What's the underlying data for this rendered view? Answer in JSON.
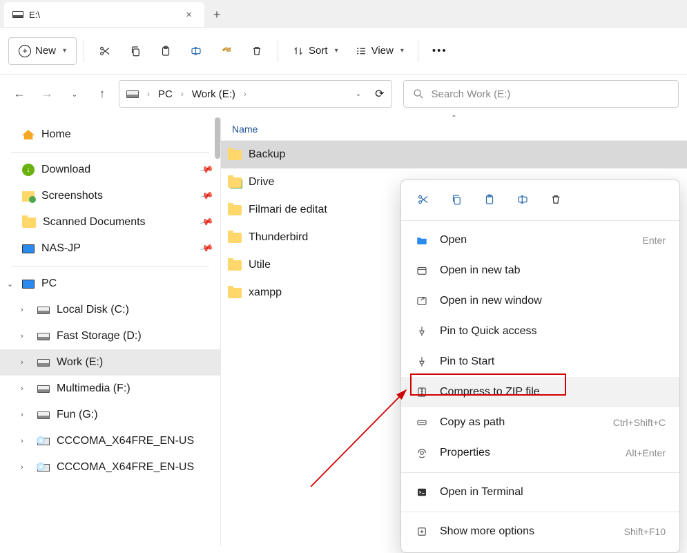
{
  "tab": {
    "title": "E:\\"
  },
  "toolbar": {
    "new": "New",
    "sort": "Sort",
    "view": "View"
  },
  "breadcrumb": {
    "pc": "PC",
    "drive": "Work (E:)"
  },
  "search": {
    "placeholder": "Search Work (E:)"
  },
  "sidebar": {
    "home": "Home",
    "quick": [
      {
        "icon": "dl",
        "label": "Download",
        "pinned": true
      },
      {
        "icon": "ss",
        "label": "Screenshots",
        "pinned": true
      },
      {
        "icon": "folder",
        "label": "Scanned Documents",
        "pinned": true
      },
      {
        "icon": "mon",
        "label": "NAS-JP",
        "pinned": true
      }
    ],
    "pc": "PC",
    "drives": [
      {
        "label": "Local Disk (C:)",
        "icon": "drive"
      },
      {
        "label": "Fast Storage (D:)",
        "icon": "drive"
      },
      {
        "label": "Work (E:)",
        "icon": "drive",
        "selected": true
      },
      {
        "label": "Multimedia (F:)",
        "icon": "drive"
      },
      {
        "label": "Fun (G:)",
        "icon": "drive"
      },
      {
        "label": "CCCOMA_X64FRE_EN-US",
        "icon": "dvd"
      },
      {
        "label": "CCCOMA_X64FRE_EN-US",
        "icon": "dvd"
      }
    ]
  },
  "file_list": {
    "header": "Name",
    "items": [
      {
        "name": "Backup",
        "selected": true
      },
      {
        "name": "Drive",
        "overlay": true
      },
      {
        "name": "Filmari de editat"
      },
      {
        "name": "Thunderbird"
      },
      {
        "name": "Utile"
      },
      {
        "name": "xampp"
      }
    ]
  },
  "context_menu": {
    "open": "Open",
    "open_shortcut": "Enter",
    "open_tab": "Open in new tab",
    "open_window": "Open in new window",
    "pin_quick": "Pin to Quick access",
    "pin_start": "Pin to Start",
    "compress": "Compress to ZIP file",
    "copy_path": "Copy as path",
    "copy_path_shortcut": "Ctrl+Shift+C",
    "properties": "Properties",
    "properties_shortcut": "Alt+Enter",
    "terminal": "Open in Terminal",
    "more": "Show more options",
    "more_shortcut": "Shift+F10"
  }
}
